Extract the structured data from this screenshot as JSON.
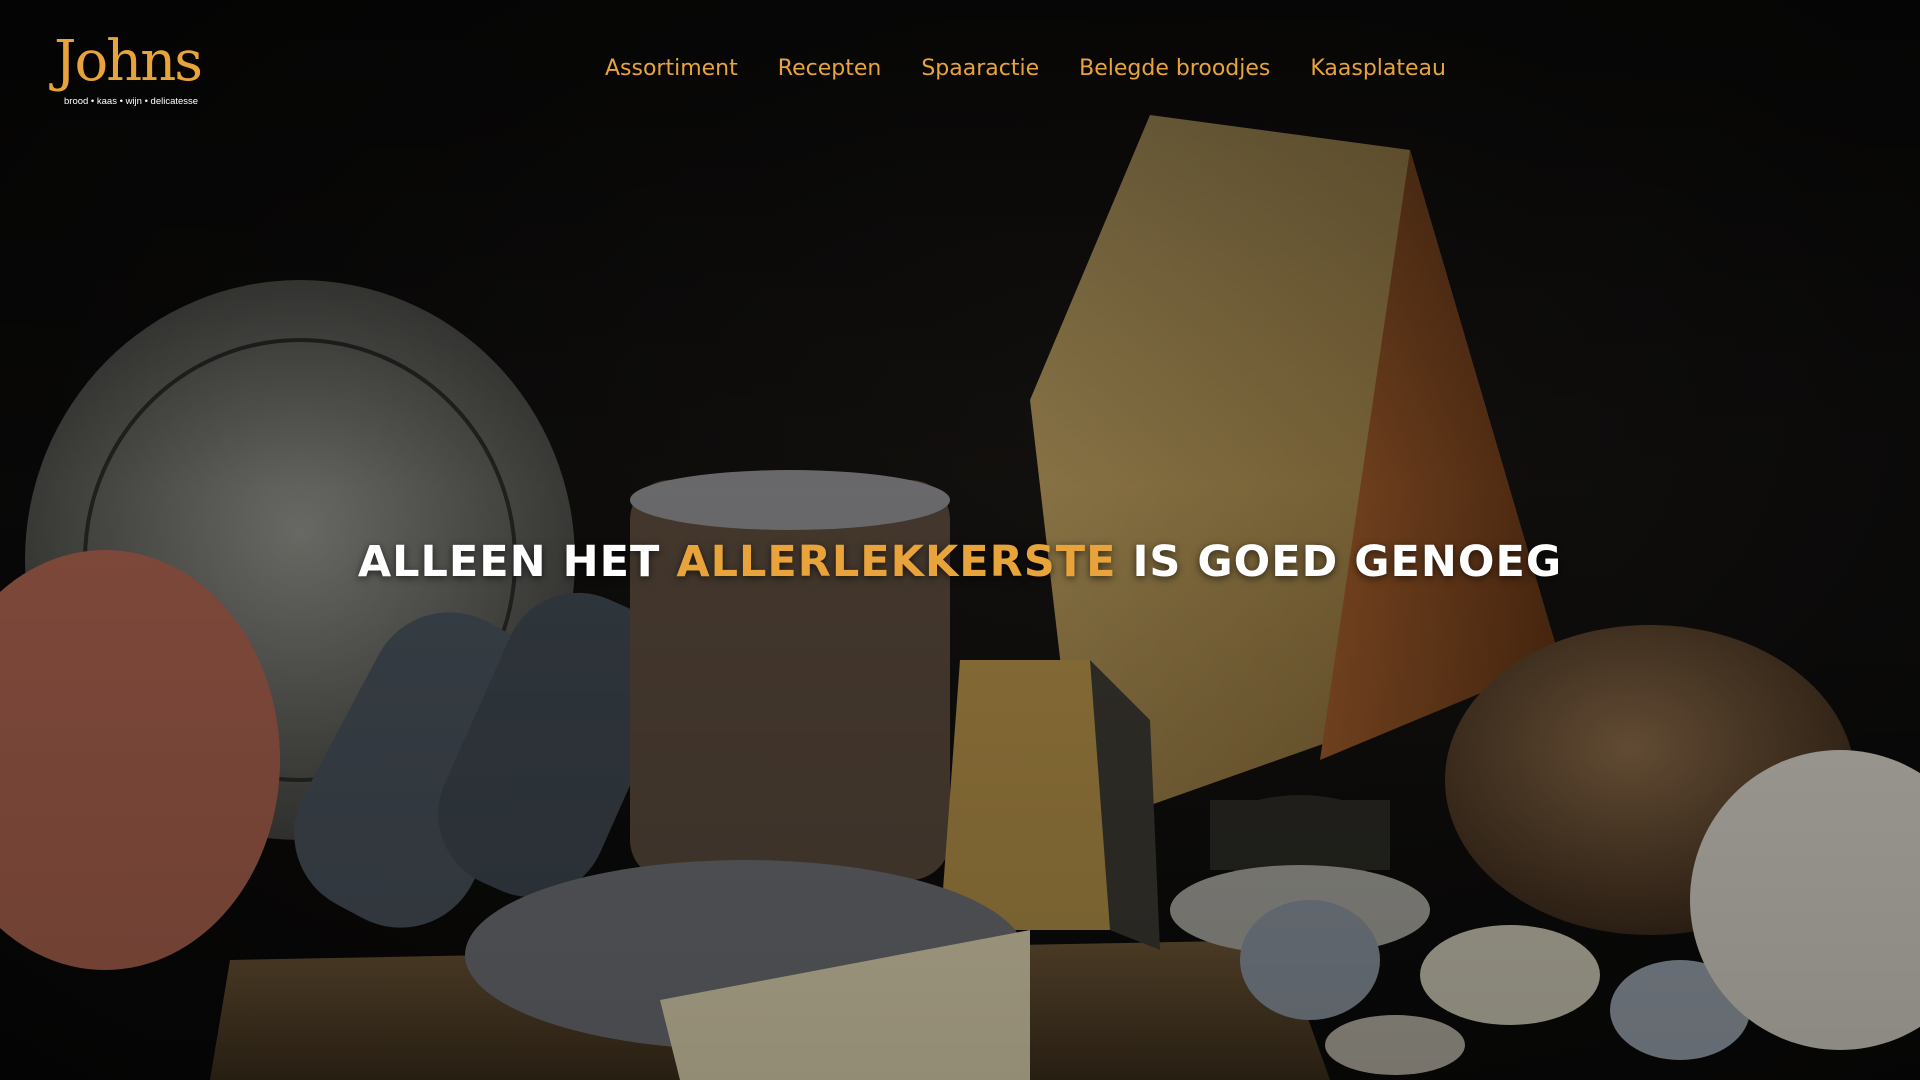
{
  "brand": {
    "name": "Johns",
    "tagline": "brood • kaas • wijn • delicatesse",
    "accent_color": "#e8a33a"
  },
  "nav": {
    "items": [
      {
        "label": "Assortiment"
      },
      {
        "label": "Recepten"
      },
      {
        "label": "Spaaractie"
      },
      {
        "label": "Belegde broodjes"
      },
      {
        "label": "Kaasplateau"
      }
    ]
  },
  "hero": {
    "headline_part1": "ALLEEN HET",
    "headline_accent": "ALLERLEKKERSTE",
    "headline_part2": "IS GOED GENOEG"
  }
}
